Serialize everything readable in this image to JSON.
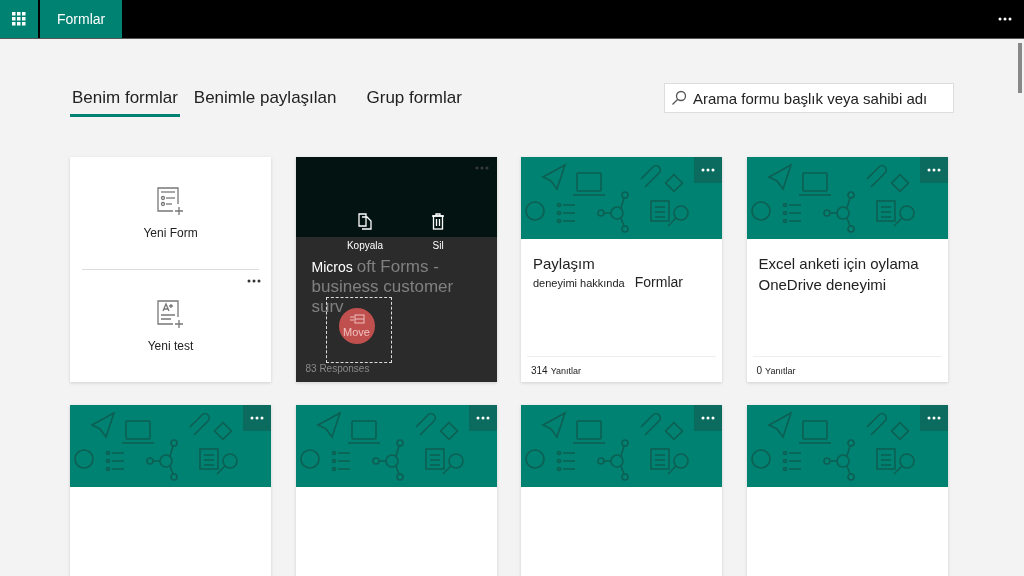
{
  "app_bar": {
    "app_name": "Formlar"
  },
  "tabs": [
    {
      "label": "Benim formlar",
      "selected": true
    },
    {
      "label": "Benimle paylaşılan",
      "selected": false
    },
    {
      "label": "Grup formlar",
      "selected": false
    }
  ],
  "search": {
    "placeholder": "Arama formu başlık veya sahibi adı"
  },
  "new_card": {
    "items": [
      {
        "kind": "form",
        "label": "Yeni Form"
      },
      {
        "kind": "quiz",
        "label": "Yeni test"
      }
    ]
  },
  "cards": [
    {
      "kind": "overlay",
      "title_visible": "Micros",
      "title_behind": [
        "oft Forms -",
        "business customer",
        "surv"
      ],
      "actions": [
        {
          "kind": "copy",
          "label": "Kopyala"
        },
        {
          "kind": "delete",
          "label": "Sil"
        }
      ],
      "drag_label": "Move",
      "responses": "83 Responses"
    },
    {
      "kind": "form",
      "title": "Paylaşım",
      "subtitle": "deneyimi hakkında",
      "tag": "Formlar",
      "count": "314",
      "count_label": "Yanıtlar"
    },
    {
      "kind": "form",
      "title": "Excel anketi için oylama OneDrive deneyimi",
      "count": "0",
      "count_label": "Yanıtlar"
    },
    {
      "kind": "form"
    },
    {
      "kind": "form"
    },
    {
      "kind": "form"
    },
    {
      "kind": "form"
    }
  ]
}
